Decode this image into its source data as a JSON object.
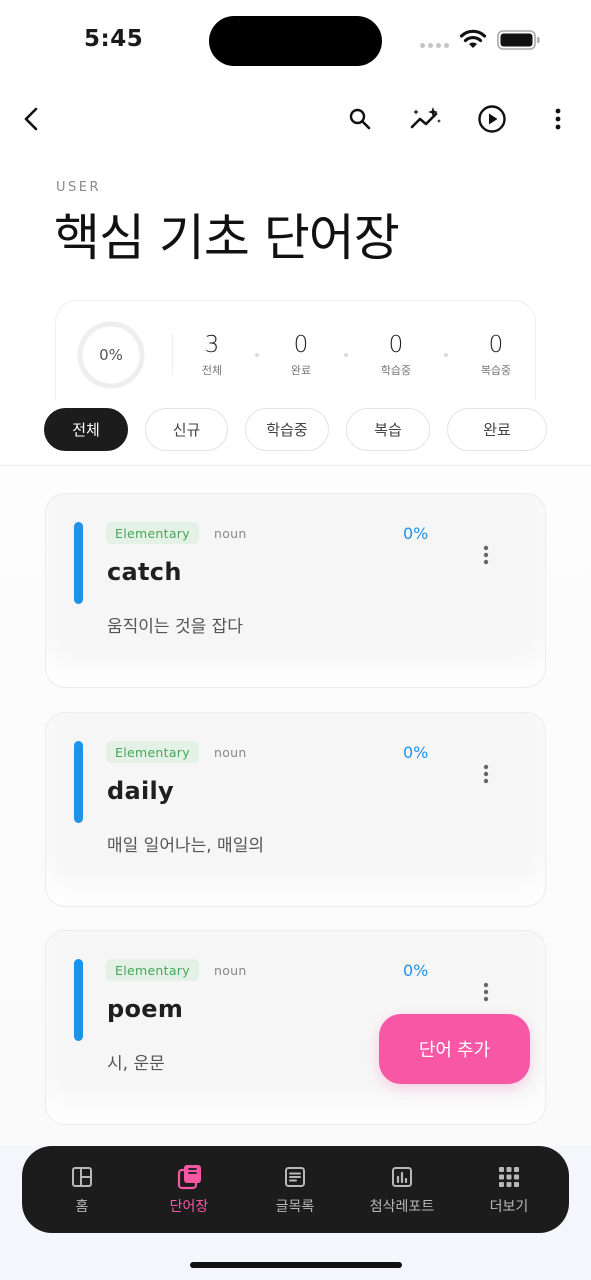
{
  "status": {
    "time": "5:45"
  },
  "toolbar": {
    "icons": [
      "chevron-left-icon",
      "search-icon",
      "sparkle-chart-icon",
      "play-circle-icon",
      "more-vertical-icon"
    ]
  },
  "header": {
    "eyebrow": "USER",
    "title": "핵심 기초 단어장"
  },
  "stats": {
    "progress_label": "0%",
    "progress": 0,
    "items": [
      {
        "value": "3",
        "label": "전체"
      },
      {
        "value": "0",
        "label": "완료"
      },
      {
        "value": "0",
        "label": "학습중"
      },
      {
        "value": "0",
        "label": "복습중"
      }
    ]
  },
  "filters": [
    {
      "label": "전체",
      "active": true
    },
    {
      "label": "신규",
      "active": false
    },
    {
      "label": "학습중",
      "active": false
    },
    {
      "label": "복습",
      "active": false
    },
    {
      "label": "완료",
      "active": false
    }
  ],
  "words": [
    {
      "level": "Elementary",
      "pos": "noun",
      "progress": "0%",
      "word": "catch",
      "meaning": "움직이는 것을 잡다"
    },
    {
      "level": "Elementary",
      "pos": "noun",
      "progress": "0%",
      "word": "daily",
      "meaning": "매일 일어나는, 매일의"
    },
    {
      "level": "Elementary",
      "pos": "noun",
      "progress": "0%",
      "word": "poem",
      "meaning": "시, 운문"
    }
  ],
  "fab": {
    "label": "단어 추가"
  },
  "nav": [
    {
      "label": "홈",
      "icon": "layout-icon",
      "active": false
    },
    {
      "label": "단어장",
      "icon": "cards-icon",
      "active": true
    },
    {
      "label": "글목록",
      "icon": "document-list-icon",
      "active": false
    },
    {
      "label": "첨삭레포트",
      "icon": "bar-chart-icon",
      "active": false
    },
    {
      "label": "더보기",
      "icon": "grid-icon",
      "active": false
    }
  ],
  "colors": {
    "accent_pink": "#f857a6",
    "accent_blue": "#1e93ea",
    "badge_green": "#48a55a",
    "nav_bg": "#1c1c1c"
  }
}
